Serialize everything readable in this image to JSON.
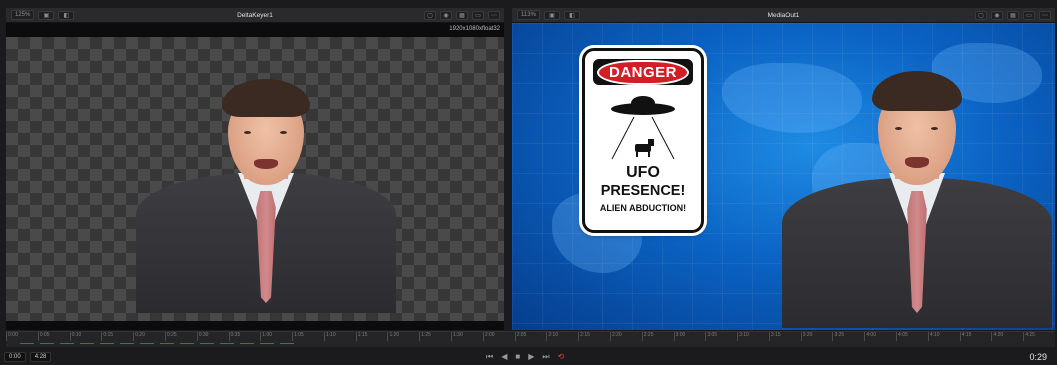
{
  "viewer_left": {
    "zoom": "125%",
    "title": "DeltaKeyer1",
    "resolution": "1920x1080xfloat32"
  },
  "viewer_right": {
    "zoom": "113%",
    "title": "MediaOut1"
  },
  "sign": {
    "header": "DANGER",
    "line1": "UFO",
    "line2": "PRESENCE!",
    "line3": "ALIEN ABDUCTION!"
  },
  "timeline": {
    "ticks": [
      "0:00",
      "0:05",
      "0:10",
      "0:15",
      "0:20",
      "0:25",
      "0:30",
      "0:35",
      "1:00",
      "1:05",
      "1:10",
      "1:15",
      "1:20",
      "1:25",
      "1:30",
      "2:00",
      "2:05",
      "2:10",
      "2:15",
      "2:20",
      "2:25",
      "3:00",
      "3:05",
      "3:10",
      "3:15",
      "3:20",
      "3:25",
      "4:00",
      "4:05",
      "4:10",
      "4:15",
      "4:20",
      "4:25"
    ],
    "start_time": "0:00",
    "end_time": "4:28",
    "current_time": "0:29"
  },
  "transport": {
    "first_icon": "skip-to-start-icon",
    "prev_icon": "reverse-play-icon",
    "stop_icon": "stop-icon",
    "play_icon": "play-icon",
    "last_icon": "skip-to-end-icon",
    "loop_icon": "loop-icon"
  },
  "colors": {
    "background": "#1b1b1d",
    "loop_accent": "#e0453a",
    "sign_red": "#d21f26"
  }
}
